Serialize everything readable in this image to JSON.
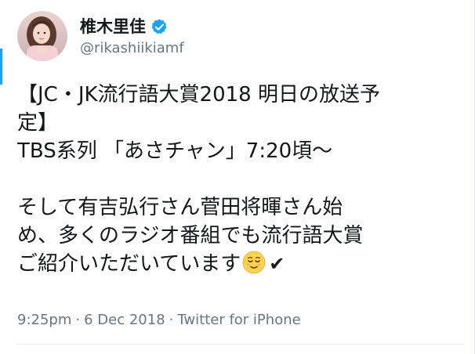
{
  "user": {
    "display_name": "椎木里佳",
    "handle": "@rikashiikiamf",
    "verified": true
  },
  "tweet": {
    "lines": [
      "【JC・JK流行語大賞2018 明日の放送予",
      "定】",
      "TBS系列 「あさチャン」7:20頃～",
      "",
      "そして有吉弘行さん菅田将暉さん始",
      "め、多くのラジオ番組でも流行語大賞",
      "ご紹介いただいています"
    ],
    "trailing_emoji": [
      "relieved-face-icon",
      "heavy-check-mark-icon"
    ],
    "check_glyph": "✔"
  },
  "meta": {
    "time": "9:25pm",
    "separator": "·",
    "date": "6 Dec 2018",
    "source": "Twitter for iPhone"
  },
  "colors": {
    "verified": "#1da1f2",
    "name": "#14171a",
    "secondary": "#657786",
    "accent": "#1da1f2"
  }
}
